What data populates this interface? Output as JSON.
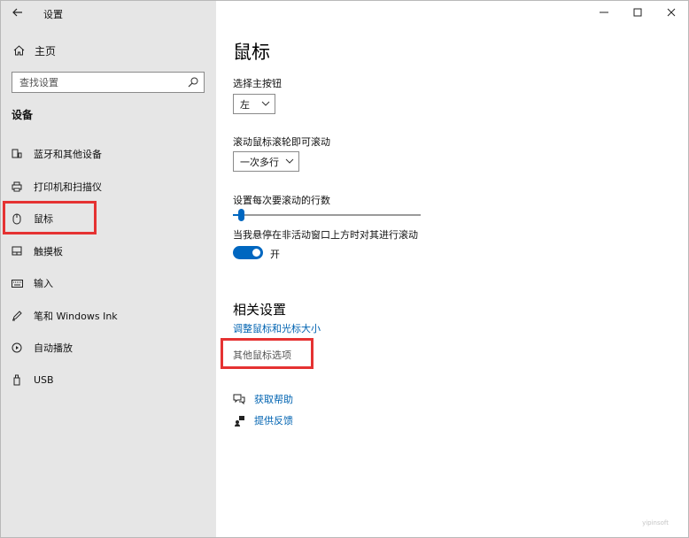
{
  "window": {
    "app_title": "设置",
    "back_icon": "arrow-left-icon",
    "controls": [
      "minimize-icon",
      "maximize-icon",
      "close-icon"
    ]
  },
  "sidebar": {
    "home_label": "主页",
    "search_placeholder": "查找设置",
    "section_title": "设备",
    "items": [
      {
        "label": "蓝牙和其他设备",
        "icon": "bluetooth-devices-icon"
      },
      {
        "label": "打印机和扫描仪",
        "icon": "printer-icon"
      },
      {
        "label": "鼠标",
        "icon": "mouse-icon",
        "selected": true
      },
      {
        "label": "触摸板",
        "icon": "touchpad-icon"
      },
      {
        "label": "输入",
        "icon": "keyboard-icon"
      },
      {
        "label": "笔和 Windows Ink",
        "icon": "pen-icon"
      },
      {
        "label": "自动播放",
        "icon": "autoplay-icon"
      },
      {
        "label": "USB",
        "icon": "usb-icon"
      }
    ]
  },
  "main": {
    "title": "鼠标",
    "primary_button": {
      "label": "选择主按钮",
      "value": "左"
    },
    "scroll_wheel": {
      "label": "滚动鼠标滚轮即可滚动",
      "value": "一次多行"
    },
    "lines_slider": {
      "label": "设置每次要滚动的行数",
      "value_fraction": 0.03
    },
    "inactive_scroll": {
      "label": "当我悬停在非活动窗口上方时对其进行滚动",
      "state": "开",
      "on": true
    },
    "related": {
      "heading": "相关设置",
      "link_resize": "调整鼠标和光标大小",
      "link_other": "其他鼠标选项"
    },
    "help": {
      "get_help": "获取帮助",
      "feedback": "提供反馈"
    },
    "watermark": "yipinsoft"
  },
  "colors": {
    "accent": "#0067c0",
    "link": "#0063b1",
    "highlight": "#e53232",
    "sidebar_bg": "#e6e6e6"
  }
}
